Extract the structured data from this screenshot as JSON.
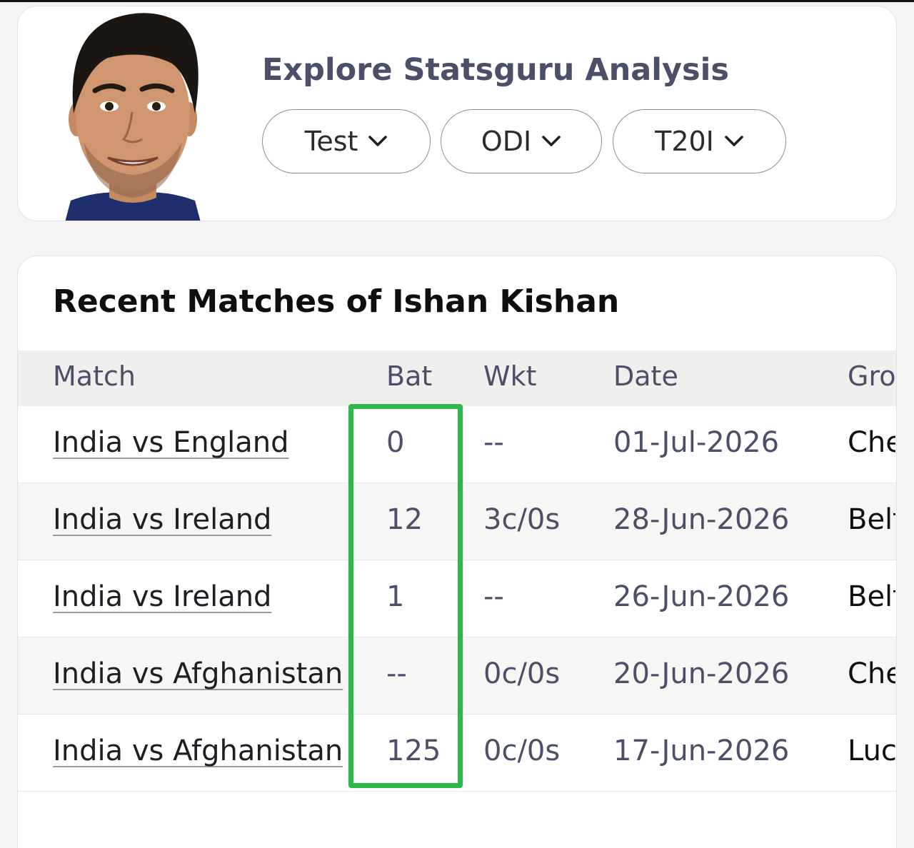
{
  "profile": {
    "avatar_icon": "player-photo",
    "explore_title": "Explore Statsguru Analysis",
    "formats": [
      "Test",
      "ODI",
      "T20I"
    ]
  },
  "recent": {
    "title": "Recent Matches of Ishan Kishan",
    "columns": [
      "Match",
      "Bat",
      "Wkt",
      "Date",
      "Gro"
    ],
    "rows": [
      {
        "match": "India vs England",
        "bat": "0",
        "wkt": "--",
        "date": "01-Jul-2026",
        "ground": "Che"
      },
      {
        "match": "India vs Ireland",
        "bat": "12",
        "wkt": "3c/0s",
        "date": "28-Jun-2026",
        "ground": "Belf"
      },
      {
        "match": "India vs Ireland",
        "bat": "1",
        "wkt": "--",
        "date": "26-Jun-2026",
        "ground": "Belf"
      },
      {
        "match": "India vs Afghanistan",
        "bat": "--",
        "wkt": "0c/0s",
        "date": "20-Jun-2026",
        "ground": "Che"
      },
      {
        "match": "India vs Afghanistan",
        "bat": "125",
        "wkt": "0c/0s",
        "date": "17-Jun-2026",
        "ground": "Luc"
      }
    ]
  },
  "colors": {
    "highlight": "#2db84a",
    "title_text": "#4b5068",
    "header_bg": "#f1efee"
  }
}
